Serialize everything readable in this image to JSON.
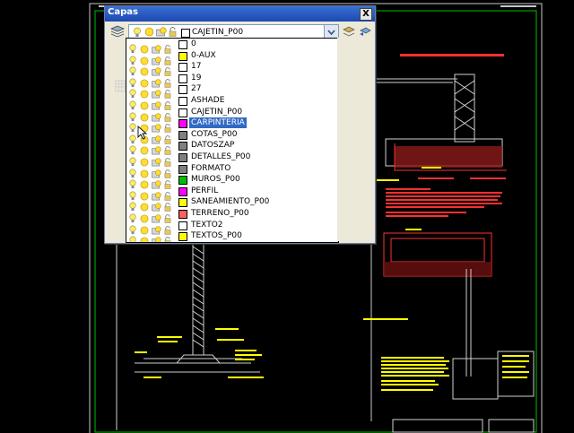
{
  "panel": {
    "title": "Capas",
    "close_label": "X",
    "current_layer": "CAJETIN_P00",
    "current_color": "#ffffff",
    "icons": {
      "manager": "layers-stack-icon",
      "make_current": "make-object-layer-current-icon",
      "previous": "layer-previous-icon"
    }
  },
  "layers": [
    {
      "name": "0",
      "color": "#ffffff",
      "selected": false
    },
    {
      "name": "0-AUX",
      "color": "#ffff00",
      "selected": false
    },
    {
      "name": "17",
      "color": "#ffffff",
      "selected": false
    },
    {
      "name": "19",
      "color": "#ffffff",
      "selected": false
    },
    {
      "name": "27",
      "color": "#ffffff",
      "selected": false
    },
    {
      "name": "ASHADE",
      "color": "#ffffff",
      "selected": false
    },
    {
      "name": "CAJETIN_P00",
      "color": "#ffffff",
      "selected": false
    },
    {
      "name": "CARPINTERIA",
      "color": "#ff00ff",
      "selected": true
    },
    {
      "name": "COTAS_P00",
      "color": "#808080",
      "selected": false
    },
    {
      "name": "DATOSZAP",
      "color": "#808080",
      "selected": false
    },
    {
      "name": "DETALLES_P00",
      "color": "#808080",
      "selected": false
    },
    {
      "name": "FORMATO",
      "color": "#808080",
      "selected": false
    },
    {
      "name": "MUROS_P00",
      "color": "#00c000",
      "selected": false
    },
    {
      "name": "PERFIL",
      "color": "#ff00ff",
      "selected": false
    },
    {
      "name": "SANEAMIENTO_P00",
      "color": "#ffff00",
      "selected": false
    },
    {
      "name": "TERRENO_P00",
      "color": "#ff6060",
      "selected": false
    },
    {
      "name": "TEXTO2",
      "color": "#ffffff",
      "selected": false
    },
    {
      "name": "TEXTOS_P00",
      "color": "#ffff00",
      "selected": false
    }
  ],
  "icons_per_row": [
    "lightbulb-on-icon",
    "sun-thaw-icon",
    "viewport-freeze-icon",
    "lock-open-icon"
  ],
  "colors": {
    "accent": "#316ac5",
    "titlebar": "#1c49b3",
    "cad_bg": "#000000"
  }
}
